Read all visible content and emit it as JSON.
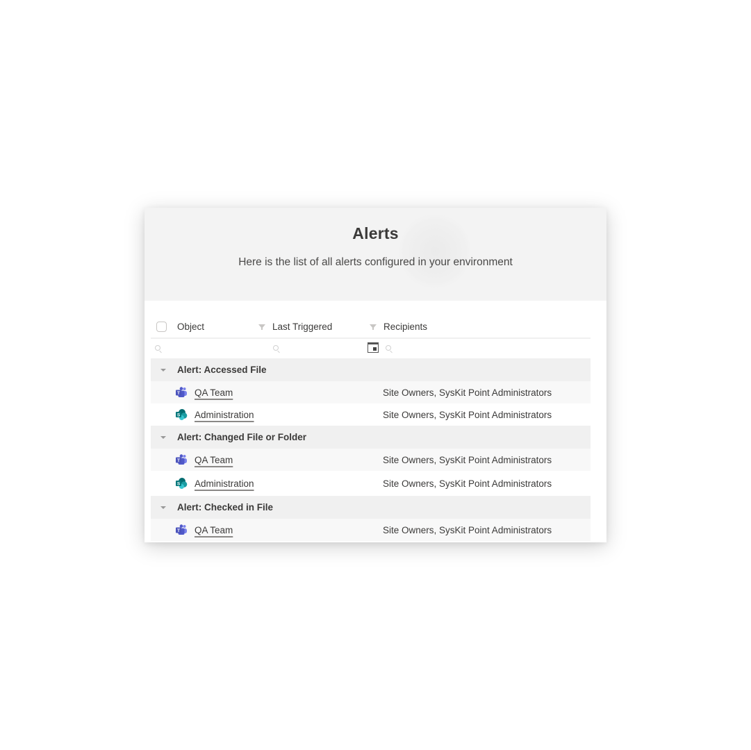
{
  "page": {
    "title": "Alerts",
    "subtitle": "Here is the list of all alerts configured in your environment"
  },
  "table": {
    "columns": [
      {
        "label": "Object",
        "filterable": false
      },
      {
        "label": "Last Triggered",
        "filterable": true
      },
      {
        "label": "Recipients",
        "filterable": true
      }
    ],
    "groups": [
      {
        "label": "Alert: Accessed File",
        "rows": [
          {
            "object": "QA Team",
            "type": "teams-icon",
            "last_triggered": "",
            "recipients": "Site Owners, SysKit Point Administrators"
          },
          {
            "object": "Administration",
            "type": "sharepoint-icon",
            "last_triggered": "",
            "recipients": "Site Owners, SysKit Point Administrators"
          }
        ]
      },
      {
        "label": "Alert: Changed File or Folder",
        "rows": [
          {
            "object": "QA Team",
            "type": "teams-icon",
            "last_triggered": "",
            "recipients": "Site Owners, SysKit Point Administrators"
          },
          {
            "object": "Administration",
            "type": "sharepoint-icon",
            "last_triggered": "",
            "recipients": "Site Owners, SysKit Point Administrators"
          }
        ]
      },
      {
        "label": "Alert: Checked in File",
        "rows": [
          {
            "object": "QA Team",
            "type": "teams-icon",
            "last_triggered": "",
            "recipients": "Site Owners, SysKit Point Administrators"
          }
        ]
      }
    ]
  },
  "colors": {
    "teams": "#5059c9",
    "sharepoint": "#038387"
  }
}
